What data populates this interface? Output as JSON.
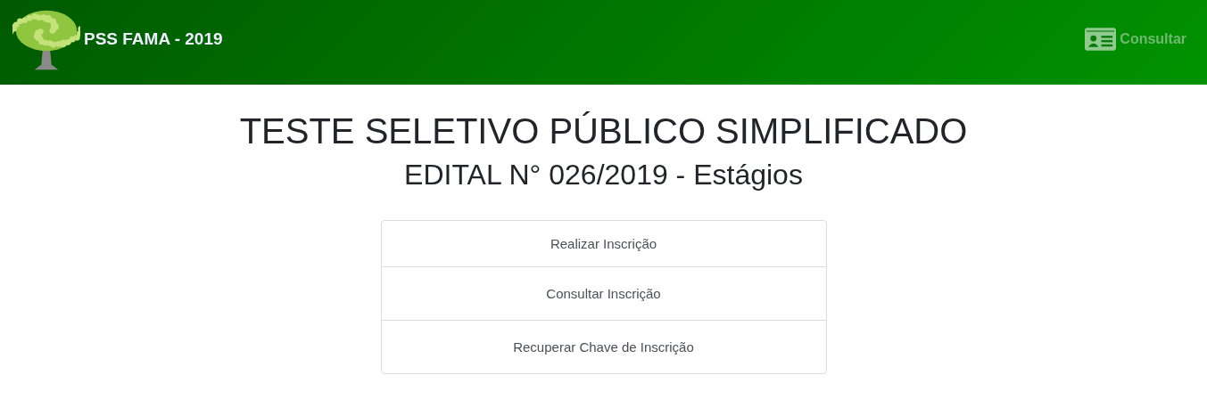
{
  "navbar": {
    "brand": "PSS FAMA - 2019",
    "link": "Consultar"
  },
  "heading": {
    "title": "TESTE SELETIVO PÚBLICO SIMPLIFICADO",
    "subtitle": "EDITAL N° 026/2019 - Estágios"
  },
  "menu": [
    "Realizar Inscrição",
    "Consultar Inscrição",
    "Recuperar Chave de Inscrição"
  ]
}
